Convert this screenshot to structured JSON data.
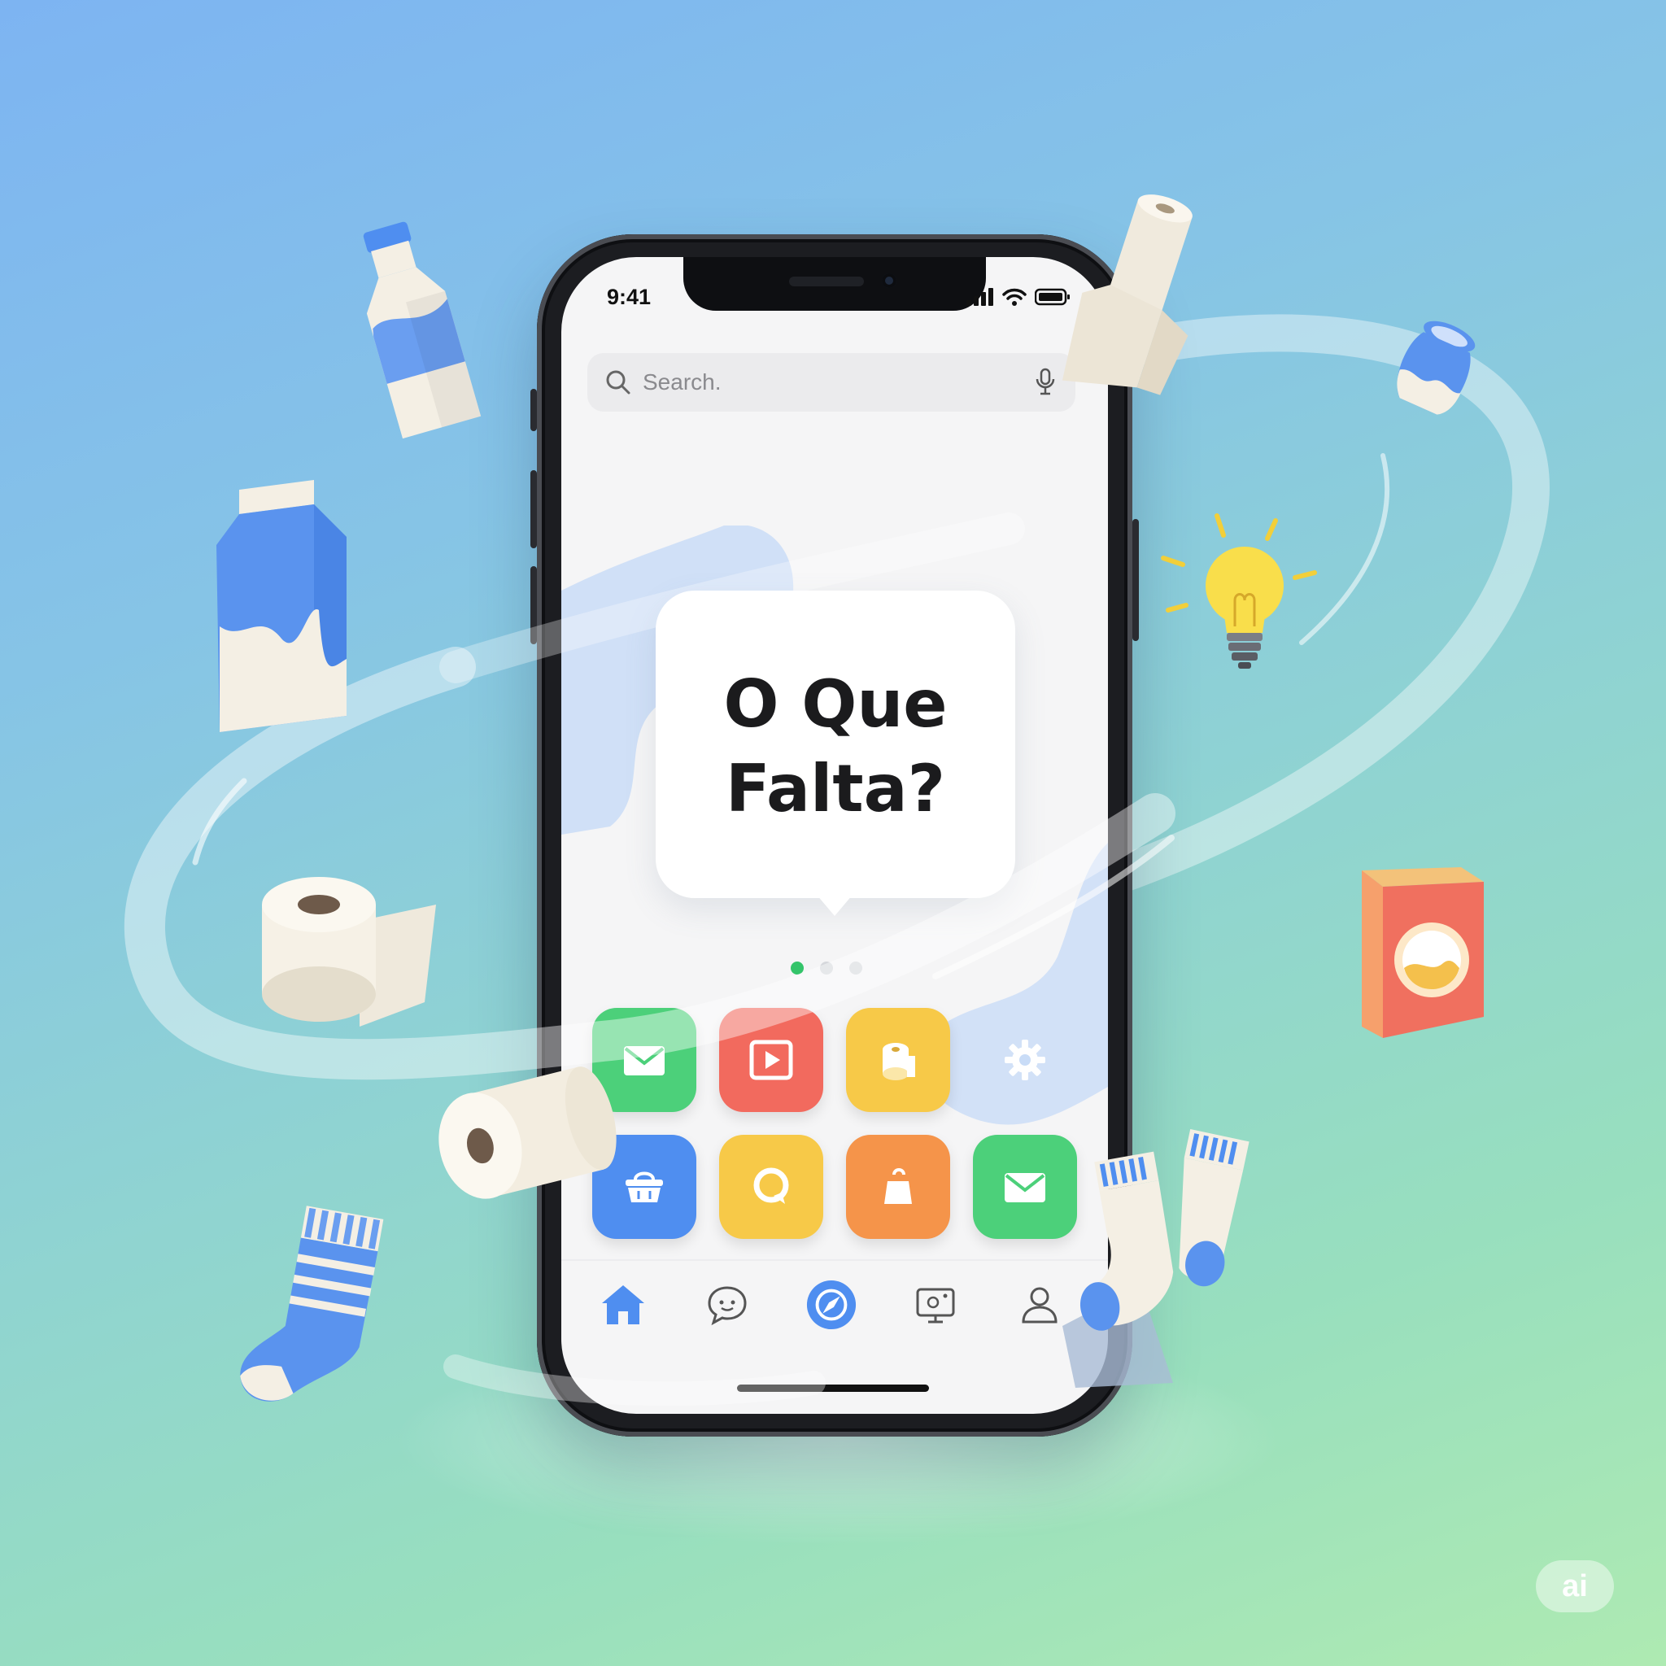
{
  "status_bar": {
    "time": "9:41"
  },
  "search": {
    "placeholder": "Search."
  },
  "hero": {
    "title": "O Que\nFalta?"
  },
  "page_indicator": {
    "count": 3,
    "active_index": 0
  },
  "apps": [
    {
      "icon": "mail-icon",
      "color": "#4cd07a"
    },
    {
      "icon": "play-icon",
      "color": "#f26a5e"
    },
    {
      "icon": "toilet-paper-icon",
      "color": "#f7c948"
    },
    {
      "icon": "gear-icon",
      "color": "#ffffff"
    },
    {
      "icon": "basket-icon",
      "color": "#4f8ef0"
    },
    {
      "icon": "chat-icon",
      "color": "#f7c948"
    },
    {
      "icon": "bag-icon",
      "color": "#f5944a"
    },
    {
      "icon": "mail-icon",
      "color": "#4cd07a"
    }
  ],
  "tab_bar": [
    {
      "icon": "home-icon",
      "active": true
    },
    {
      "icon": "chat-bubble-icon",
      "active": false
    },
    {
      "icon": "compass-icon",
      "active": false
    },
    {
      "icon": "screen-icon",
      "active": false
    },
    {
      "icon": "profile-icon",
      "active": false
    }
  ],
  "badge": {
    "label": "ai"
  },
  "colors": {
    "accent_blue": "#4f8ef0",
    "accent_green": "#34c46a",
    "background_top": "#7db4f2",
    "background_bottom": "#aeeab2"
  },
  "floating_items": [
    "milk-bottle-icon",
    "milk-carton-icon",
    "toilet-paper-roll-icon",
    "toilet-paper-roll-icon",
    "sock-icon",
    "socks-icon",
    "light-bulb-icon",
    "yogurt-jar-icon",
    "cereal-box-icon",
    "paper-towel-icon"
  ]
}
